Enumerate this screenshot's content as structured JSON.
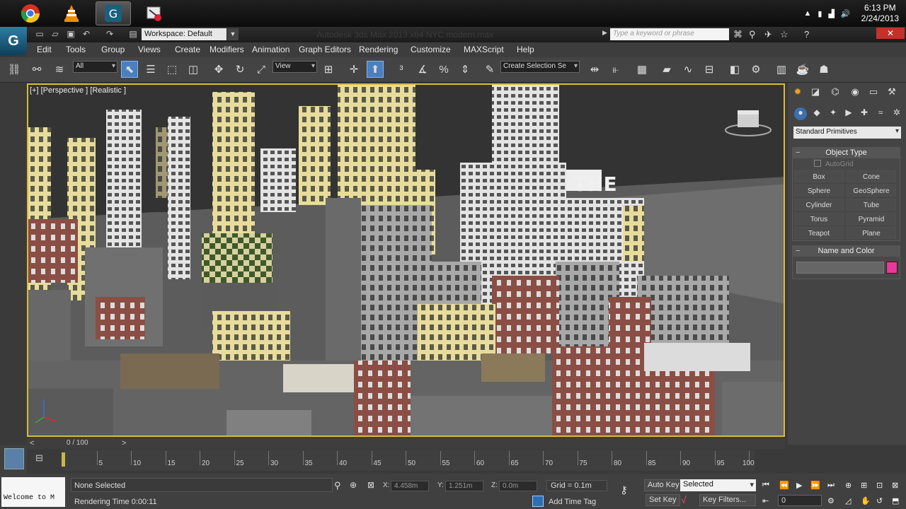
{
  "taskbar": {
    "apps": [
      {
        "name": "chrome-icon"
      },
      {
        "name": "vlc-icon"
      },
      {
        "name": "3dsmax-icon"
      },
      {
        "name": "snipping-tool-icon"
      }
    ],
    "clock_time": "6:13 PM",
    "clock_date": "2/24/2013"
  },
  "titlebar": {
    "workspace_value": "Workspace: Default",
    "window_title": "Autodesk 3ds Max  2013 x64     NYC modern.max",
    "search_placeholder": "Type a keyword or phrase",
    "close_symbol": "✕"
  },
  "menu": {
    "items": [
      "Edit",
      "Tools",
      "Group",
      "Views",
      "Create",
      "Modifiers",
      "Animation",
      "Graph Editors",
      "Rendering",
      "Customize",
      "MAXScript",
      "Help"
    ]
  },
  "toolbar": {
    "selection_filter": "All",
    "reference_coord": "View",
    "named_selection": "Create Selection Se"
  },
  "viewport": {
    "label": "[+] [Perspective ] [Realistic ]",
    "sign_text": "THE"
  },
  "command_panel": {
    "category": "Standard Primitives",
    "object_type_title": "Object Type",
    "autogrid_label": "AutoGrid",
    "buttons": [
      "Box",
      "Cone",
      "Sphere",
      "GeoSphere",
      "Cylinder",
      "Tube",
      "Torus",
      "Pyramid",
      "Teapot",
      "Plane"
    ],
    "name_color_title": "Name and Color",
    "object_color": "#e8399a"
  },
  "timeline": {
    "frame_label": "0 / 100",
    "ticks": [
      "5",
      "10",
      "15",
      "20",
      "25",
      "30",
      "35",
      "40",
      "45",
      "50",
      "55",
      "60",
      "65",
      "70",
      "75",
      "80",
      "85",
      "90",
      "95",
      "100"
    ],
    "current_frame_fraction": 0
  },
  "status": {
    "maxscript_text": "Welcome to M",
    "selection_status": "None Selected",
    "render_time": "Rendering Time  0:00:11",
    "x_label": "X:",
    "x_value": "4.458m",
    "y_label": "Y:",
    "y_value": "1.251m",
    "z_label": "Z:",
    "z_value": "0.0m",
    "grid": "Grid = 0.1m",
    "add_time_tag": "Add Time Tag",
    "auto_key": "Auto Key",
    "set_key": "Set Key",
    "key_mode": "Selected",
    "key_filters": "Key Filters...",
    "current_frame": "0"
  }
}
